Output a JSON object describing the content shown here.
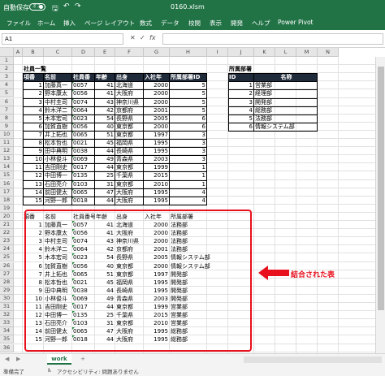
{
  "titlebar": {
    "autosave_label": "自動保存",
    "toggle_label": "オフ",
    "file_name": "0160.xlsm"
  },
  "ribbon": {
    "tabs": [
      "ファイル",
      "ホーム",
      "挿入",
      "ページ レイアウト",
      "数式",
      "データ",
      "校閲",
      "表示",
      "開発",
      "ヘルプ",
      "Power Pivot"
    ]
  },
  "formula_bar": {
    "name_box": "A1",
    "formula": ""
  },
  "columns": [
    "A",
    "B",
    "C",
    "D",
    "E",
    "F",
    "G",
    "H",
    "I",
    "J",
    "K",
    "L",
    "M",
    "N"
  ],
  "rows": [
    "1",
    "2",
    "3",
    "4",
    "5",
    "6",
    "7",
    "8",
    "9",
    "10",
    "11",
    "12",
    "13",
    "14",
    "15",
    "16",
    "17",
    "18",
    "19",
    "20",
    "21",
    "22",
    "23",
    "24",
    "25",
    "26",
    "27",
    "28",
    "29",
    "30",
    "31",
    "32",
    "33",
    "34",
    "35",
    "36"
  ],
  "table1": {
    "title": "社員一覧",
    "headers": [
      "項番",
      "名前",
      "社員番号",
      "年齢",
      "出身",
      "入社年",
      "所属部署ID"
    ],
    "rows": [
      [
        "1",
        "加藤真一",
        "0057",
        "41",
        "北海道",
        "2000",
        "5"
      ],
      [
        "2",
        "野本康太",
        "0056",
        "41",
        "大阪府",
        "2000",
        "5"
      ],
      [
        "3",
        "中村圭司",
        "0074",
        "43",
        "神奈川県",
        "2000",
        "5"
      ],
      [
        "4",
        "鈴木洋二",
        "0064",
        "42",
        "京都府",
        "2001",
        "5"
      ],
      [
        "5",
        "木本宏司",
        "0023",
        "54",
        "長野県",
        "2005",
        "6"
      ],
      [
        "6",
        "加賀直樹",
        "0056",
        "40",
        "東京都",
        "2000",
        "6"
      ],
      [
        "7",
        "井上拓也",
        "0065",
        "51",
        "東京都",
        "1997",
        "3"
      ],
      [
        "8",
        "松本哲也",
        "0021",
        "45",
        "福岡県",
        "1995",
        "3"
      ],
      [
        "9",
        "田中典明",
        "0038",
        "44",
        "長崎県",
        "1995",
        "3"
      ],
      [
        "10",
        "小林俊斗",
        "0069",
        "49",
        "青森県",
        "2003",
        "3"
      ],
      [
        "11",
        "吉田剛史",
        "0017",
        "44",
        "東京都",
        "1999",
        "1"
      ],
      [
        "12",
        "中田博一",
        "0135",
        "25",
        "千葉県",
        "2015",
        "1"
      ],
      [
        "13",
        "石田亮介",
        "0103",
        "31",
        "東京都",
        "2010",
        "1"
      ],
      [
        "14",
        "前田健太",
        "0065",
        "47",
        "大阪府",
        "1995",
        "4"
      ],
      [
        "15",
        "河野一郎",
        "0018",
        "44",
        "大阪府",
        "1995",
        "4"
      ]
    ]
  },
  "table2": {
    "title": "所属部署",
    "headers": [
      "ID",
      "名称"
    ],
    "rows": [
      [
        "1",
        "営業部"
      ],
      [
        "2",
        "経理部"
      ],
      [
        "3",
        "開発部"
      ],
      [
        "4",
        "総務部"
      ],
      [
        "5",
        "法務部"
      ],
      [
        "6",
        "情報システム部"
      ]
    ]
  },
  "table3": {
    "headers": [
      "項番",
      "名前",
      "社員番号",
      "年齢",
      "出身",
      "入社年",
      "所属部署"
    ],
    "rows": [
      [
        "1",
        "加藤真一",
        "0057",
        "41",
        "北海道",
        "2000",
        "法務部"
      ],
      [
        "2",
        "野本康太",
        "0056",
        "41",
        "大阪府",
        "2000",
        "法務部"
      ],
      [
        "3",
        "中村圭司",
        "0074",
        "43",
        "神奈川県",
        "2000",
        "法務部"
      ],
      [
        "4",
        "鈴木洋二",
        "0064",
        "42",
        "京都府",
        "2001",
        "法務部"
      ],
      [
        "5",
        "木本宏司",
        "0023",
        "54",
        "長野県",
        "2005",
        "情報システム部"
      ],
      [
        "6",
        "加賀直樹",
        "0056",
        "40",
        "東京都",
        "2000",
        "情報システム部"
      ],
      [
        "7",
        "井上拓也",
        "0065",
        "51",
        "東京都",
        "1997",
        "開発部"
      ],
      [
        "8",
        "松本哲也",
        "0021",
        "45",
        "福岡県",
        "1995",
        "開発部"
      ],
      [
        "9",
        "田中典明",
        "0038",
        "44",
        "長崎県",
        "1995",
        "開発部"
      ],
      [
        "10",
        "小林俊斗",
        "0069",
        "49",
        "青森県",
        "2003",
        "開発部"
      ],
      [
        "11",
        "吉田剛史",
        "0017",
        "44",
        "東京都",
        "1999",
        "営業部"
      ],
      [
        "12",
        "中田博一",
        "0135",
        "25",
        "千葉県",
        "2015",
        "営業部"
      ],
      [
        "13",
        "石田亮介",
        "0103",
        "31",
        "東京都",
        "2010",
        "営業部"
      ],
      [
        "14",
        "前田健太",
        "0065",
        "47",
        "大阪府",
        "1995",
        "総務部"
      ],
      [
        "15",
        "河野一郎",
        "0018",
        "44",
        "大阪府",
        "1995",
        "総務部"
      ]
    ]
  },
  "annotation": {
    "label": "結合された表",
    "color": "#e8101c"
  },
  "sheet_tabs": {
    "active": "work",
    "add_label": "+"
  },
  "status": {
    "ready": "準備完了",
    "accessibility": "アクセシビリティ: 問題ありません"
  },
  "colors": {
    "excel_green": "#217346",
    "table_header_fill": "#1f2a3a",
    "red_accent": "#e8101c"
  }
}
